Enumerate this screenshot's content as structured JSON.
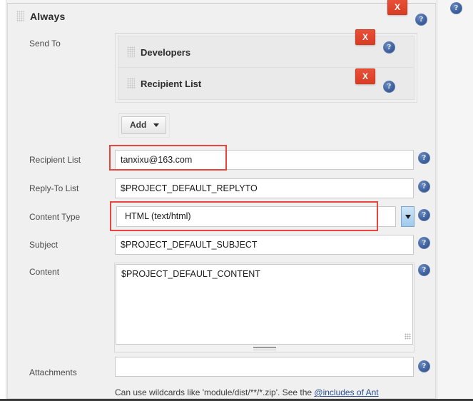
{
  "section": {
    "title": "Always",
    "grip_icon": "drag-handle-icon",
    "delete_label": "X",
    "help_icon": "help-icon"
  },
  "send_to": {
    "label": "Send To",
    "rows": [
      {
        "title": "Developers",
        "delete_label": "X"
      },
      {
        "title": "Recipient List",
        "delete_label": "X"
      }
    ],
    "add_label": "Add"
  },
  "fields": {
    "recipient_list": {
      "label": "Recipient List",
      "value": "tanxixu@163.com",
      "highlighted": true
    },
    "reply_to_list": {
      "label": "Reply-To List",
      "value": "$PROJECT_DEFAULT_REPLYTO",
      "highlighted": false
    },
    "content_type": {
      "label": "Content Type",
      "value": "HTML (text/html)",
      "options": [
        "HTML (text/html)"
      ],
      "highlighted": true
    },
    "subject": {
      "label": "Subject",
      "value": "$PROJECT_DEFAULT_SUBJECT",
      "highlighted": false
    },
    "content": {
      "label": "Content",
      "value": "$PROJECT_DEFAULT_CONTENT",
      "highlighted": false
    },
    "attachments": {
      "label": "Attachments",
      "value": "",
      "highlighted": false
    }
  },
  "footer": {
    "hint_prefix": "Can use wildcards like 'module/dist/**/*.zip'. See the ",
    "hint_link": "@includes of Ant"
  },
  "colors": {
    "delete_red": "#d93d22",
    "help_blue": "#41639f",
    "highlight_red": "#e8463c",
    "panel_bg": "#f0f0f0",
    "link_blue": "#2d4f8f"
  }
}
